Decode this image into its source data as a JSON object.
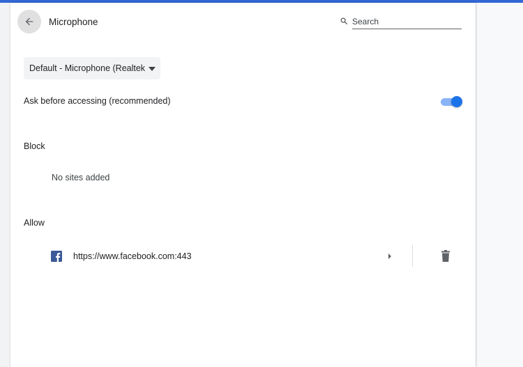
{
  "header": {
    "title": "Microphone",
    "back_icon": "arrow-back-icon"
  },
  "search": {
    "placeholder": "Search",
    "value": "",
    "icon": "search-icon"
  },
  "device": {
    "selected": "Default - Microphone (Realtek",
    "icon": "caret-down-icon"
  },
  "ask": {
    "label": "Ask before accessing (recommended)",
    "enabled": true
  },
  "block": {
    "heading": "Block",
    "empty_text": "No sites added"
  },
  "allow": {
    "heading": "Allow",
    "sites": [
      {
        "url": "https://www.facebook.com:443",
        "favicon": "facebook-icon"
      }
    ]
  },
  "colors": {
    "top_strip": "#3367d6",
    "toggle_on": "#1a73e8",
    "toggle_track": "#8ab4f8",
    "facebook_blue": "#3b5998"
  }
}
